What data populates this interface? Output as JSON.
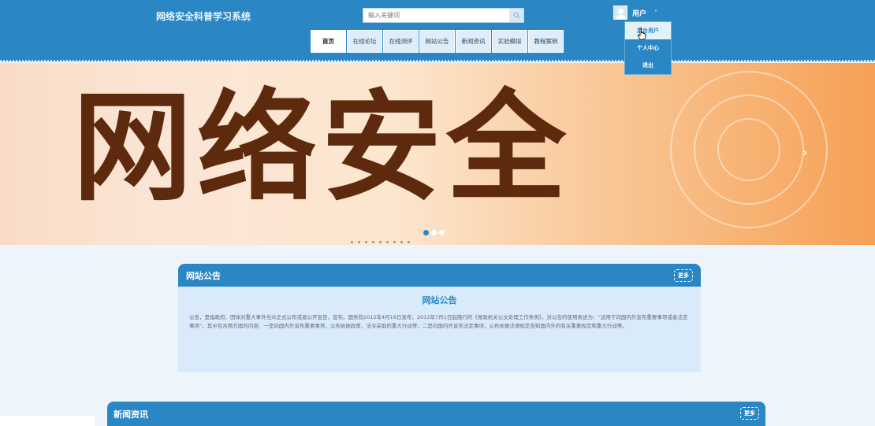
{
  "header": {
    "site_title": "网络安全科普学习系统",
    "search_placeholder": "输入关键词",
    "search_icon": "search-icon",
    "user_label": "用户",
    "user_chevron": "˅"
  },
  "nav": {
    "items": [
      "首页",
      "在线论坛",
      "在线测评",
      "网站公告",
      "新闻资讯",
      "实验模拟",
      "教程案例"
    ],
    "active_index": 0
  },
  "user_menu": {
    "items": [
      "后台用户",
      "个人中心",
      "退出"
    ],
    "hovered_index": 0
  },
  "banner": {
    "text": "网络安全",
    "next_arrow": "›",
    "slide_count": 3,
    "active_slide": 0
  },
  "notice_panel": {
    "header_title": "网站公告",
    "more_label": "更多",
    "title": "网站公告",
    "body": "公告，是指政府、团体对重大事件当众正式公布或者公开宣告，宣布。国务院2012年4月16日发布、2012年7月1日起施行的《党政机关公文处理工作条例》，对公告的使用表述为：“适用于向国内外宣布重要事项或者法定事项”。其中包含两方面的内容：一是向国内外宣布重要事项，公布依据政策，法令采取的重大行动等；二是向国内外宣布法定事项，公布依据法律规定告知国内外的有关重要规定和重大行动等。"
  },
  "news_panel": {
    "header_title": "新闻资讯",
    "more_label": "更多"
  },
  "colors": {
    "primary": "#2a87c4",
    "banner_text": "#5e2a0e",
    "panel_bg": "#d9ebfa"
  }
}
